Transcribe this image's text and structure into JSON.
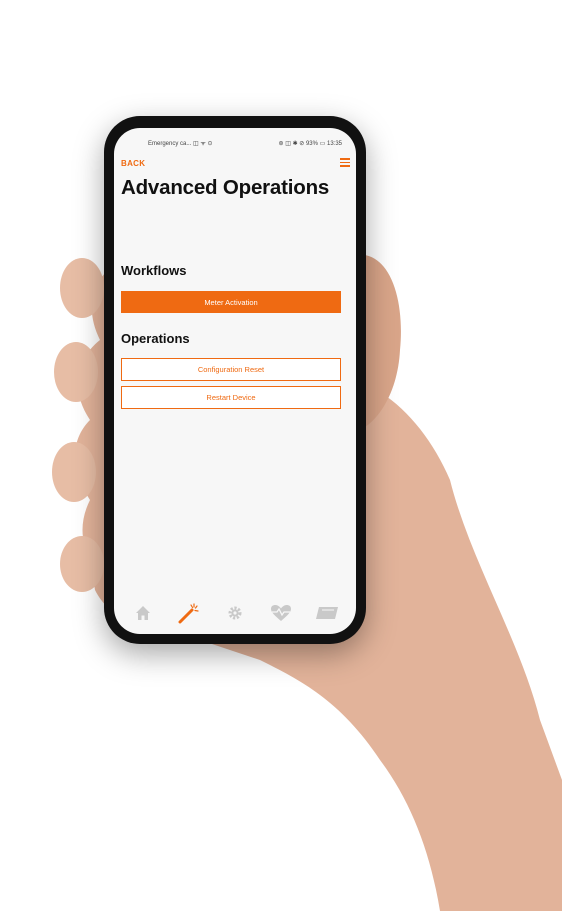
{
  "status_bar": {
    "left": "Emergency ca... ◫ ᯤ ⊙",
    "right": "⊛ ◫ ✱ ⊘ 93% ▭ 13:35"
  },
  "nav": {
    "back_label": "BACK",
    "menu_icon": "hamburger-icon"
  },
  "page_title": "Advanced Operations",
  "workflows": {
    "heading": "Workflows",
    "buttons": [
      {
        "label": "Meter Activation"
      }
    ]
  },
  "operations": {
    "heading": "Operations",
    "buttons": [
      {
        "label": "Configuration Reset"
      },
      {
        "label": "Restart Device"
      }
    ]
  },
  "tabs": [
    {
      "icon": "home-icon",
      "active": false
    },
    {
      "icon": "magic-wand-icon",
      "active": true
    },
    {
      "icon": "gear-icon",
      "active": false
    },
    {
      "icon": "heartbeat-icon",
      "active": false
    },
    {
      "icon": "meter-icon",
      "active": false
    }
  ],
  "colors": {
    "accent": "#ef6a12",
    "inactive_icon": "#c9c9c9"
  }
}
